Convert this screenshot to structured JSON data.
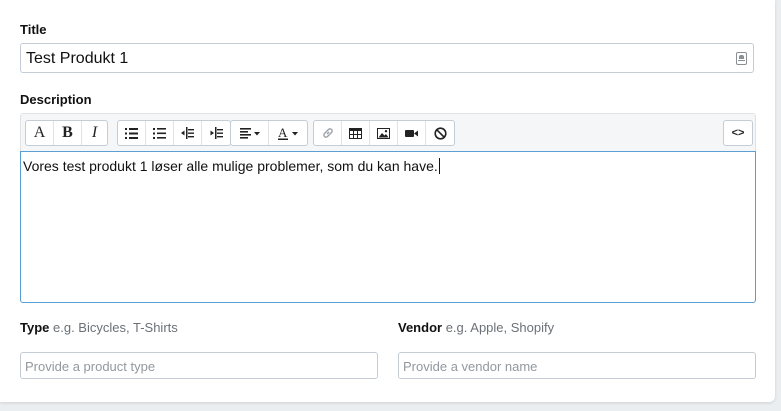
{
  "title_field": {
    "label": "Title",
    "value": "Test Produkt 1",
    "icon": "contact-card-icon"
  },
  "description": {
    "label": "Description",
    "toolbar": {
      "font_label": "A",
      "bold_label": "B",
      "italic_label": "I",
      "code_view_label": "<>",
      "icons": [
        "font-style",
        "bold",
        "italic",
        "unordered-list",
        "ordered-list",
        "outdent",
        "indent",
        "paragraph-align",
        "text-color",
        "link",
        "table",
        "picture",
        "video",
        "clear-format",
        "code-view"
      ]
    },
    "content": "Vores test produkt 1 løser alle mulige problemer, som du kan have."
  },
  "type_field": {
    "label": "Type",
    "hint": "e.g. Bicycles, T-Shirts",
    "placeholder": "Provide a product type"
  },
  "vendor_field": {
    "label": "Vendor",
    "hint": "e.g. Apple, Shopify",
    "placeholder": "Provide a vendor name"
  },
  "colors": {
    "focus_border": "#5c9fd4",
    "border": "#c4cdd5",
    "background": "#ebeef0"
  }
}
